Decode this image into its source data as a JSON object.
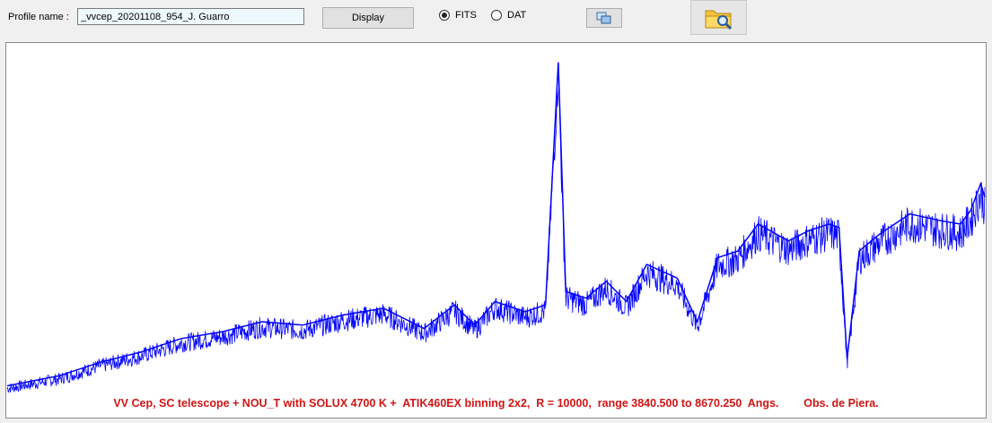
{
  "toolbar": {
    "profile_label": "Profile name :",
    "profile_value": "_vvcep_20201108_954_J. Guarro",
    "display_label": "Display",
    "format_options": [
      {
        "label": "FITS",
        "selected": true
      },
      {
        "label": "DAT",
        "selected": false
      }
    ],
    "copy_icon": "copy-icon",
    "open_icon": "folder-search-icon"
  },
  "plot": {
    "caption": "VV Cep, SC telescope + NOU_T with SOLUX 4700 K +  ATIK460EX binning 2x2,  R = 10000,  range 3840.500 to 8670.250  Angs.        Obs. de Piera.",
    "line_color": "#0000ff",
    "caption_color": "#d21414"
  },
  "chart_data": {
    "type": "line",
    "xlim": [
      3840.5,
      8670.25
    ],
    "xlabel": "",
    "ylabel": "",
    "grid": false,
    "series": [
      {
        "color": "#0000ff",
        "x": [
          3840.5,
          4100,
          4300,
          4500,
          4700,
          4900,
          5100,
          5300,
          5500,
          5700,
          5900,
          6050,
          6150,
          6250,
          6400,
          6500,
          6563,
          6600,
          6700,
          6800,
          6900,
          7000,
          7150,
          7250,
          7350,
          7450,
          7550,
          7700,
          7800,
          7900,
          7950,
          7990,
          8050,
          8150,
          8300,
          8450,
          8550,
          8600,
          8650,
          8670.25
        ],
        "y": [
          0.02,
          0.05,
          0.09,
          0.12,
          0.16,
          0.18,
          0.21,
          0.2,
          0.23,
          0.25,
          0.19,
          0.26,
          0.2,
          0.27,
          0.24,
          0.26,
          0.98,
          0.3,
          0.28,
          0.33,
          0.27,
          0.38,
          0.34,
          0.21,
          0.4,
          0.42,
          0.5,
          0.45,
          0.48,
          0.5,
          0.49,
          0.1,
          0.42,
          0.47,
          0.53,
          0.51,
          0.5,
          0.54,
          0.62,
          0.58
        ]
      }
    ],
    "caption": "VV Cep, SC telescope + NOU_T with SOLUX 4700 K +  ATIK460EX binning 2x2,  R = 10000,  range 3840.500 to 8670.250  Angs.        Obs. de Piera."
  }
}
